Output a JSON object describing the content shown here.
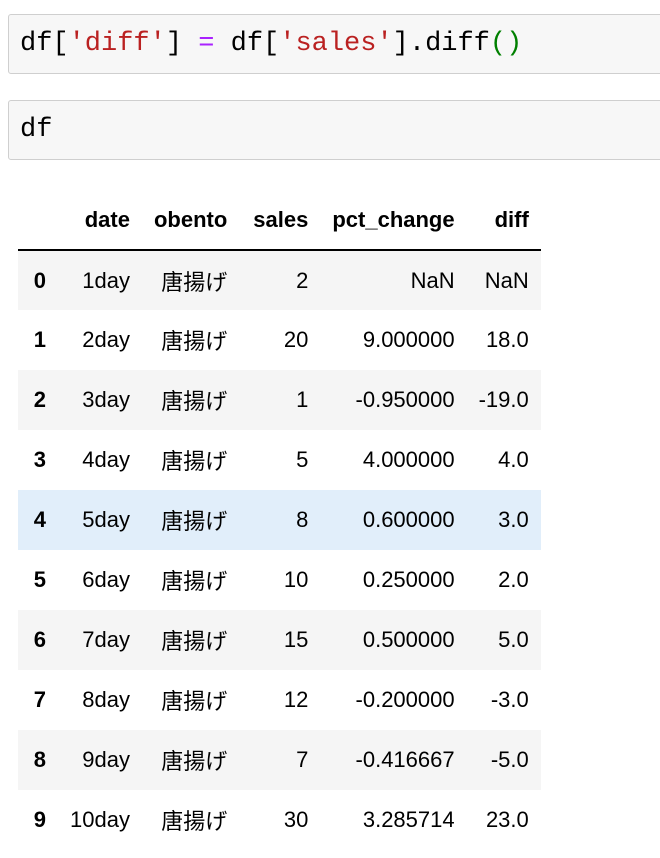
{
  "cells": [
    {
      "tokens": [
        {
          "text": "df[",
          "cls": "tok-var"
        },
        {
          "text": "'diff'",
          "cls": "tok-str"
        },
        {
          "text": "] ",
          "cls": "tok-var"
        },
        {
          "text": "=",
          "cls": "tok-op"
        },
        {
          "text": " df[",
          "cls": "tok-var"
        },
        {
          "text": "'sales'",
          "cls": "tok-str"
        },
        {
          "text": "].diff",
          "cls": "tok-var"
        },
        {
          "text": "()",
          "cls": "tok-paren"
        }
      ]
    },
    {
      "tokens": [
        {
          "text": "df",
          "cls": "tok-var"
        }
      ]
    }
  ],
  "table": {
    "columns": [
      "",
      "date",
      "obento",
      "sales",
      "pct_change",
      "diff"
    ],
    "rows": [
      {
        "index": "0",
        "date": "1day",
        "obento": "唐揚げ",
        "sales": "2",
        "pct_change": "NaN",
        "diff": "NaN"
      },
      {
        "index": "1",
        "date": "2day",
        "obento": "唐揚げ",
        "sales": "20",
        "pct_change": "9.000000",
        "diff": "18.0"
      },
      {
        "index": "2",
        "date": "3day",
        "obento": "唐揚げ",
        "sales": "1",
        "pct_change": "-0.950000",
        "diff": "-19.0"
      },
      {
        "index": "3",
        "date": "4day",
        "obento": "唐揚げ",
        "sales": "5",
        "pct_change": "4.000000",
        "diff": "4.0"
      },
      {
        "index": "4",
        "date": "5day",
        "obento": "唐揚げ",
        "sales": "8",
        "pct_change": "0.600000",
        "diff": "3.0",
        "hover": true
      },
      {
        "index": "5",
        "date": "6day",
        "obento": "唐揚げ",
        "sales": "10",
        "pct_change": "0.250000",
        "diff": "2.0"
      },
      {
        "index": "6",
        "date": "7day",
        "obento": "唐揚げ",
        "sales": "15",
        "pct_change": "0.500000",
        "diff": "5.0"
      },
      {
        "index": "7",
        "date": "8day",
        "obento": "唐揚げ",
        "sales": "12",
        "pct_change": "-0.200000",
        "diff": "-3.0"
      },
      {
        "index": "8",
        "date": "9day",
        "obento": "唐揚げ",
        "sales": "7",
        "pct_change": "-0.416667",
        "diff": "-5.0"
      },
      {
        "index": "9",
        "date": "10day",
        "obento": "唐揚げ",
        "sales": "30",
        "pct_change": "3.285714",
        "diff": "23.0"
      }
    ]
  },
  "colors": {
    "string": "#ba2121",
    "operator": "#aa22ff",
    "paren": "#008000",
    "row_striped": "#f5f5f5",
    "row_hover": "#e1eefa"
  }
}
